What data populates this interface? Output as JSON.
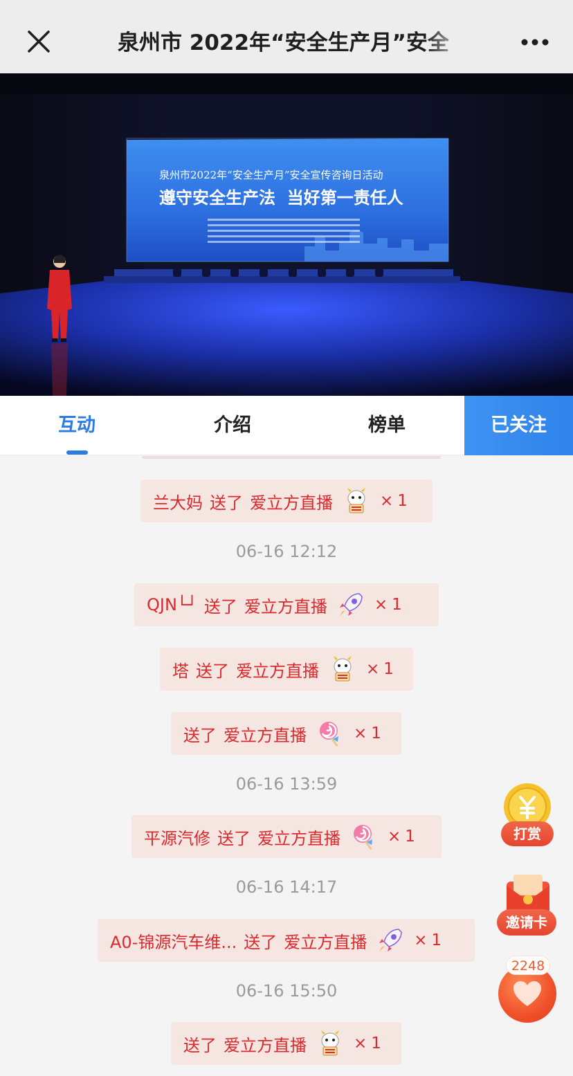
{
  "header": {
    "title": "泉州市 2022年“安全生产月”安全",
    "close_icon": "close-icon",
    "more_icon": "more-icon"
  },
  "video": {
    "screen_line1": "泉州市2022年“安全生产月”安全宣传咨询日活动",
    "screen_line2": "遵守安全生产法  当好第一责任人"
  },
  "tabs": [
    {
      "label": "互动",
      "active": true
    },
    {
      "label": "介绍",
      "active": false
    },
    {
      "label": "榜单",
      "active": false
    }
  ],
  "follow_label": "已关注",
  "feed": {
    "items": [
      {
        "name": "兰大妈",
        "verb": "送了",
        "channel": "爱立方直播",
        "gift": "dragon-mascot-icon",
        "times": "×",
        "count": "1"
      },
      {
        "timestamp": "06-16 12:12"
      },
      {
        "name": "QJN└┘",
        "verb": "送了",
        "channel": "爱立方直播",
        "gift": "rocket-icon",
        "times": "×",
        "count": "1"
      },
      {
        "name": "塔",
        "verb": "送了",
        "channel": "爱立方直播",
        "gift": "dragon-mascot-icon",
        "times": "×",
        "count": "1"
      },
      {
        "name": "",
        "verb": "送了",
        "channel": "爱立方直播",
        "gift": "lollipop-icon",
        "times": "×",
        "count": "1"
      },
      {
        "timestamp": "06-16 13:59"
      },
      {
        "name": "平源汽修",
        "verb": "送了",
        "channel": "爱立方直播",
        "gift": "lollipop-icon",
        "times": "×",
        "count": "1"
      },
      {
        "timestamp": "06-16 14:17"
      },
      {
        "name": "A0-锦源汽车维...",
        "verb": "送了",
        "channel": "爱立方直播",
        "gift": "rocket-icon",
        "times": "×",
        "count": "1"
      },
      {
        "timestamp": "06-16 15:50"
      },
      {
        "name": "",
        "verb": "送了",
        "channel": "爱立方直播",
        "gift": "dragon-mascot-icon",
        "times": "×",
        "count": "1"
      }
    ]
  },
  "floating": {
    "reward_label": "打赏",
    "reward_icon": "yen-coin-icon",
    "invite_label": "邀请卡",
    "invite_icon": "red-envelope-icon",
    "like_count": "2248",
    "like_icon": "heart-icon"
  },
  "colors": {
    "accent_blue": "#2b7be3",
    "gift_red": "#d9292c",
    "pill_bg": "#f5e6e2",
    "fab_orange": "#ef5a2e"
  }
}
